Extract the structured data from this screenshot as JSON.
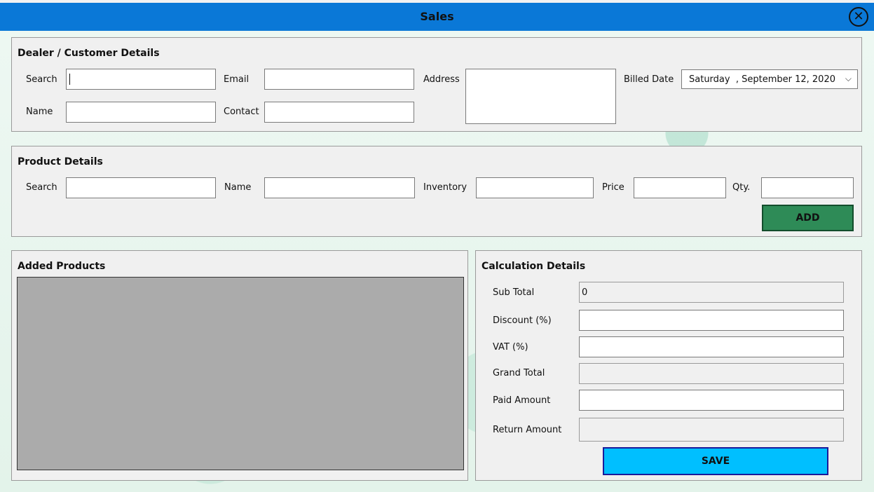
{
  "window": {
    "title": "Sales",
    "close_icon": "close-circle-icon"
  },
  "dealer": {
    "section_title": "Dealer / Customer Details",
    "search_label": "Search",
    "search_value": "",
    "name_label": "Name",
    "name_value": "",
    "email_label": "Email",
    "email_value": "",
    "contact_label": "Contact",
    "contact_value": "",
    "address_label": "Address",
    "address_value": "",
    "billed_date_label": "Billed Date",
    "billed_date_value": "Saturday  , September 12, 2020"
  },
  "product": {
    "section_title": "Product Details",
    "search_label": "Search",
    "name_label": "Name",
    "inventory_label": "Inventory",
    "price_label": "Price",
    "qty_label": "Qty.",
    "add_label": "ADD"
  },
  "added_products": {
    "section_title": "Added Products"
  },
  "calculation": {
    "section_title": "Calculation Details",
    "sub_total_label": "Sub Total",
    "sub_total_value": "0",
    "discount_label": "Discount (%)",
    "vat_label": "VAT (%)",
    "grand_total_label": "Grand Total",
    "paid_amount_label": "Paid Amount",
    "return_amount_label": "Return Amount",
    "save_label": "SAVE"
  },
  "colors": {
    "titlebar": "#0a78d7",
    "add_button": "#2e8b57",
    "save_button": "#00bfff",
    "grid": "#ababab"
  }
}
